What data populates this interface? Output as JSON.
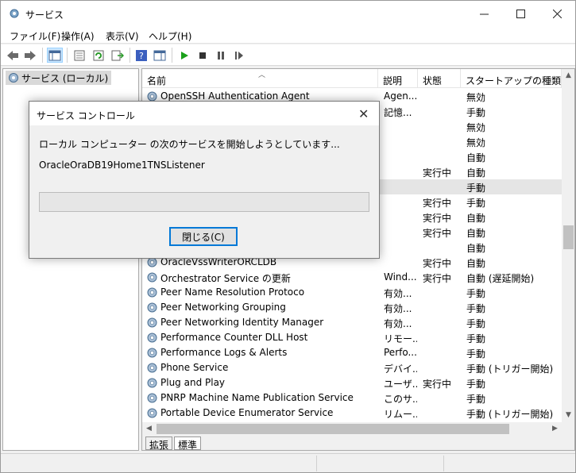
{
  "window": {
    "title": "サービス"
  },
  "menu": [
    "ファイル(F)",
    "操作(A)",
    "表示(V)",
    "ヘルプ(H)"
  ],
  "tree": {
    "root_label": "サービス (ローカル)"
  },
  "columns": {
    "name": "名前",
    "description": "説明",
    "status": "状態",
    "startup": "スタートアップの種類"
  },
  "services": [
    {
      "name": "OpenSSH Authentication Agent",
      "desc": "Agen...",
      "status": "",
      "startup": "無効"
    },
    {
      "name": "",
      "desc": "記憶...",
      "status": "",
      "startup": "手動"
    },
    {
      "name": "",
      "desc": "",
      "status": "",
      "startup": "無効"
    },
    {
      "name": "",
      "desc": "",
      "status": "",
      "startup": "無効"
    },
    {
      "name": "",
      "desc": "",
      "status": "",
      "startup": "自動"
    },
    {
      "name": "",
      "desc": "",
      "status": "実行中",
      "startup": "自動"
    },
    {
      "name": "",
      "desc": "",
      "status": "",
      "startup": "手動"
    },
    {
      "name": "",
      "desc": "",
      "status": "実行中",
      "startup": "手動"
    },
    {
      "name": "",
      "desc": "",
      "status": "実行中",
      "startup": "自動"
    },
    {
      "name": "",
      "desc": "",
      "status": "実行中",
      "startup": "自動"
    },
    {
      "name": "",
      "desc": "",
      "status": "",
      "startup": "自動"
    },
    {
      "name": "OracleVssWriterORCLDB",
      "desc": "",
      "status": "実行中",
      "startup": "自動"
    },
    {
      "name": "Orchestrator Service の更新",
      "desc": "Wind...",
      "status": "実行中",
      "startup": "自動 (遅延開始)"
    },
    {
      "name": "Peer Name Resolution Protoco",
      "desc": "有効...",
      "status": "",
      "startup": "手動"
    },
    {
      "name": "Peer Networking Grouping",
      "desc": "有効...",
      "status": "",
      "startup": "手動"
    },
    {
      "name": "Peer Networking Identity Manager",
      "desc": "有効...",
      "status": "",
      "startup": "手動"
    },
    {
      "name": "Performance Counter DLL Host",
      "desc": "リモー...",
      "status": "",
      "startup": "手動"
    },
    {
      "name": "Performance Logs & Alerts",
      "desc": "Perfo...",
      "status": "",
      "startup": "手動"
    },
    {
      "name": "Phone Service",
      "desc": "デバイ...",
      "status": "",
      "startup": "手動 (トリガー開始)"
    },
    {
      "name": "Plug and Play",
      "desc": "ユーザ...",
      "status": "実行中",
      "startup": "手動"
    },
    {
      "name": "PNRP Machine Name Publication Service",
      "desc": "このサ...",
      "status": "",
      "startup": "手動"
    },
    {
      "name": "Portable Device Enumerator Service",
      "desc": "リムー...",
      "status": "",
      "startup": "手動 (トリガー開始)"
    }
  ],
  "tabs": [
    "拡張",
    "標準"
  ],
  "dialog": {
    "title": "サービス コントロール",
    "message": "ローカル コンピューター の次のサービスを開始しようとしています...",
    "service_name": "OracleOraDB19Home1TNSListener",
    "close_button": "閉じる(C)",
    "progress": 0.0
  },
  "colors": {
    "accent": "#0078d7",
    "progress_fill": "#06b025",
    "selection": "#e5e5e5"
  }
}
